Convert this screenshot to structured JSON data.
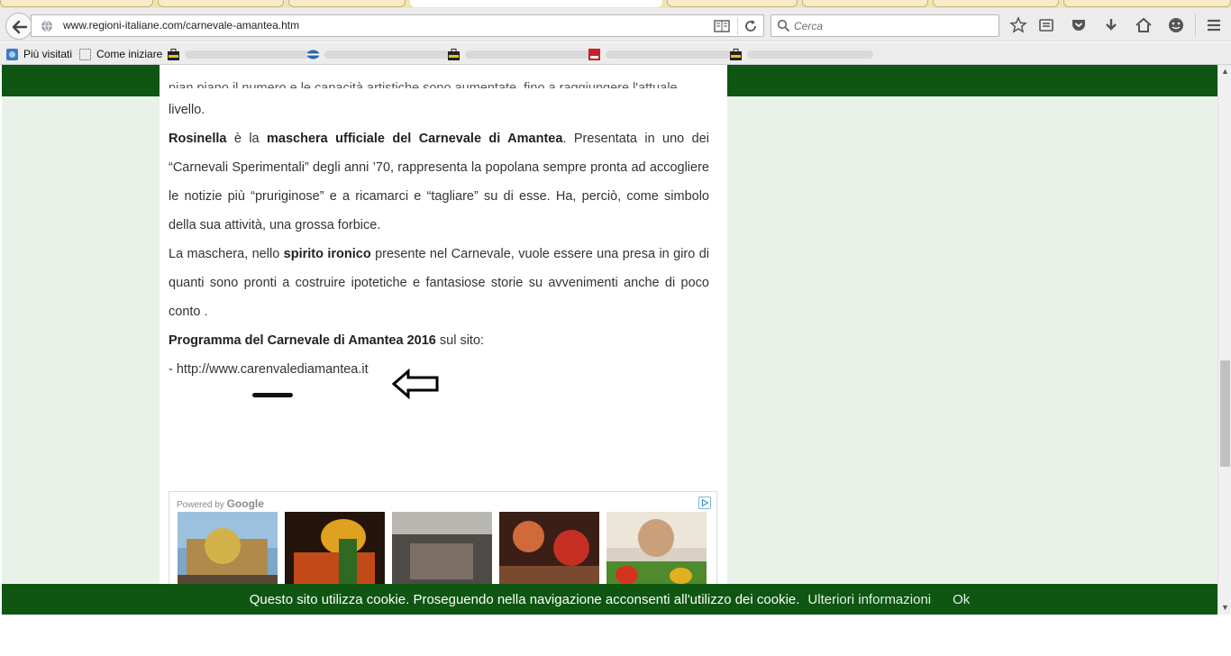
{
  "browser": {
    "url": "www.regioni-italiane.com/carnevale-amantea.htm",
    "search_placeholder": "Cerca",
    "bookmarks": [
      {
        "label": "Più visitati",
        "icon": "firefox-icon"
      },
      {
        "label": "Come iniziare",
        "icon": "page-icon"
      }
    ]
  },
  "article": {
    "cut_off_line": "pian piano il numero e le capacità artistiche sono aumentate, fino a raggiungere l'attuale",
    "p1_end": "livello.",
    "p2_name": "Rosinella",
    "p2_a": " è la ",
    "p2_bold": "maschera ufficiale del Carnevale di Amantea",
    "p2_b": ". Presentata in uno dei “Carnevali Sperimentali” degli anni ’70, rappresenta la popolana sempre pronta ad accogliere le notizie più “pruriginose” e a ricamarci e “tagliare” su di esse. Ha, perciò, come simbolo della sua attività, una grossa forbice.",
    "p3_a": "La maschera, nello ",
    "p3_bold": "spirito ironico",
    "p3_b": " presente nel Carnevale, vuole essere una presa in giro di quanti sono pronti a costruire ipotetiche e fantasiose storie su avvenimenti anche di poco conto .",
    "p4_bold": "Programma del Carnevale di Amantea 2016",
    "p4_rest": " sul sito:",
    "link_text": "- http://www.carenvalediamantea.it"
  },
  "ad": {
    "powered_by": "Powered by",
    "google": "Google"
  },
  "cookie": {
    "message": "Questo sito utilizza cookie. Proseguendo nella navigazione acconsenti all'utilizzo dei cookie.",
    "more_info": "Ulteriori informazioni",
    "ok": "Ok"
  },
  "colors": {
    "site_green": "#0e5612",
    "page_bg": "#e9f2e9"
  }
}
